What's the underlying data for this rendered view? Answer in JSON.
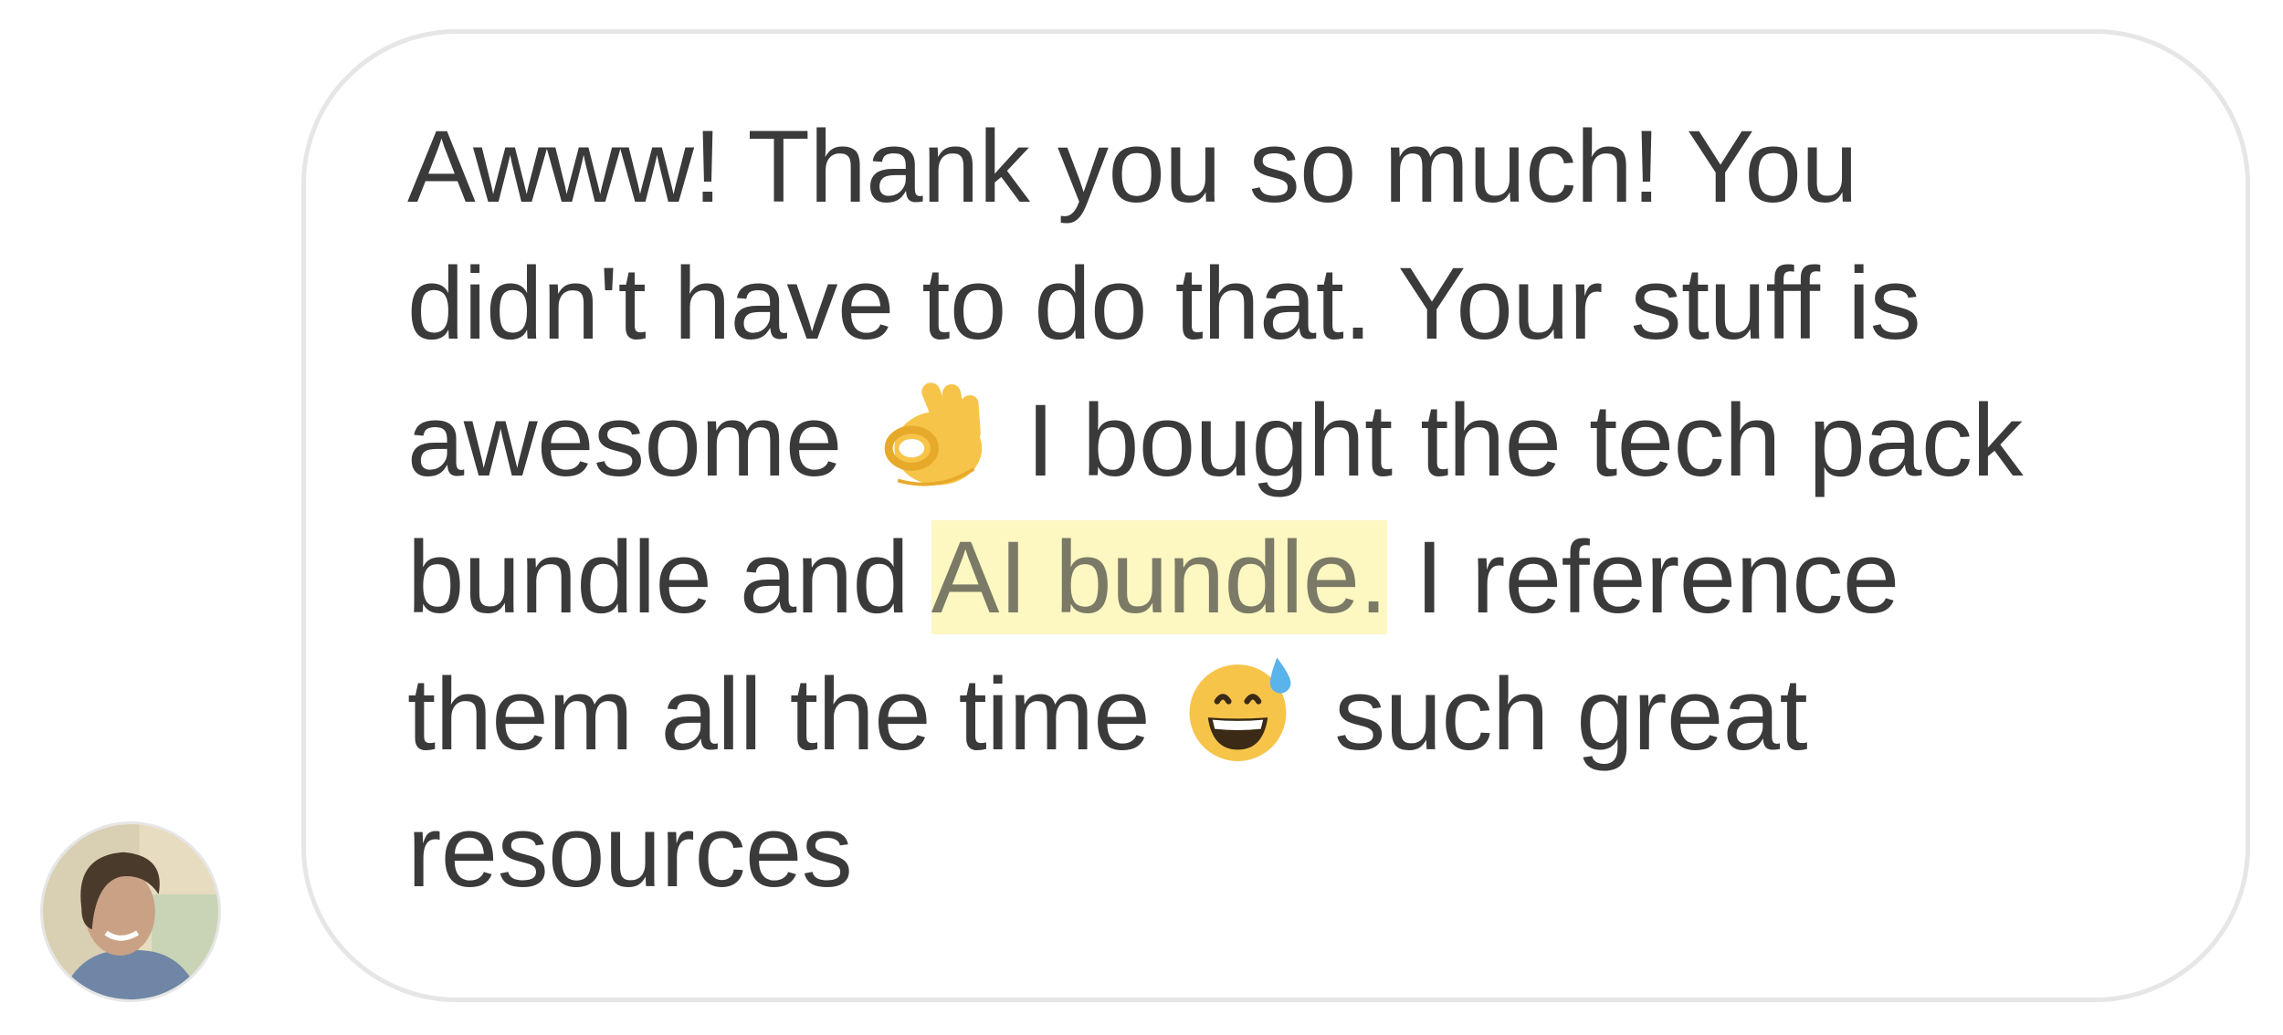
{
  "message": {
    "line1": "Awww! Thank you so much! You",
    "line2": "didn't have to do that. Your stuff is",
    "line3_a": "awesome",
    "line3_emoji": "ok-hand-icon",
    "line3_b": "I bought the tech pack",
    "line4_a": "bundle and ",
    "line4_highlight": "AI bundle.",
    "line4_b": " I reference",
    "line5_a": "them all the time",
    "line5_emoji": "grinning-sweat-icon",
    "line5_b": "such great",
    "line6": "resources"
  },
  "colors": {
    "text": "#3a3a3a",
    "highlight": "#fdf7c2",
    "bubble_border": "#e6e6e6"
  }
}
